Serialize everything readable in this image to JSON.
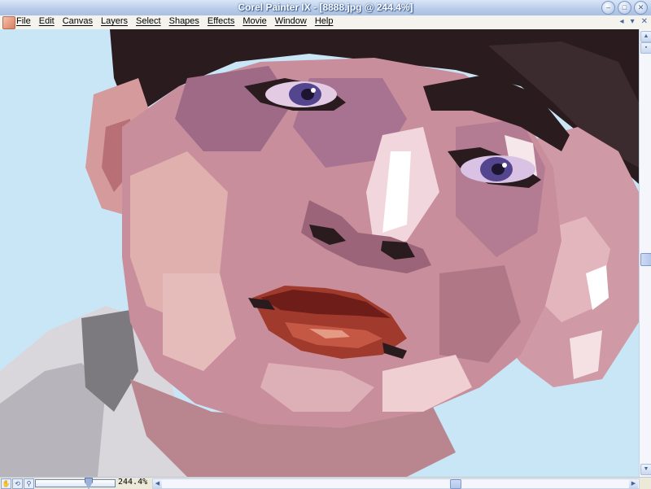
{
  "window": {
    "title": "Corel Painter IX - [8888.jpg @ 244.4%]",
    "controls": [
      "minimize",
      "maximize",
      "close"
    ]
  },
  "menubar": {
    "items": [
      "File",
      "Edit",
      "Canvas",
      "Layers",
      "Select",
      "Shapes",
      "Effects",
      "Movie",
      "Window",
      "Help"
    ]
  },
  "mdi_controls": [
    "◂",
    "▾",
    "✕"
  ],
  "status": {
    "zoom_text": "244.4%",
    "zoom_level": 0.66
  },
  "colors": {
    "background": "#c9e6f7",
    "skin": "#c88e9c",
    "lips": "#a03a2c",
    "hair": "#2a1b1e",
    "eyes": "#54468e",
    "shirt": "#dad8dc"
  }
}
